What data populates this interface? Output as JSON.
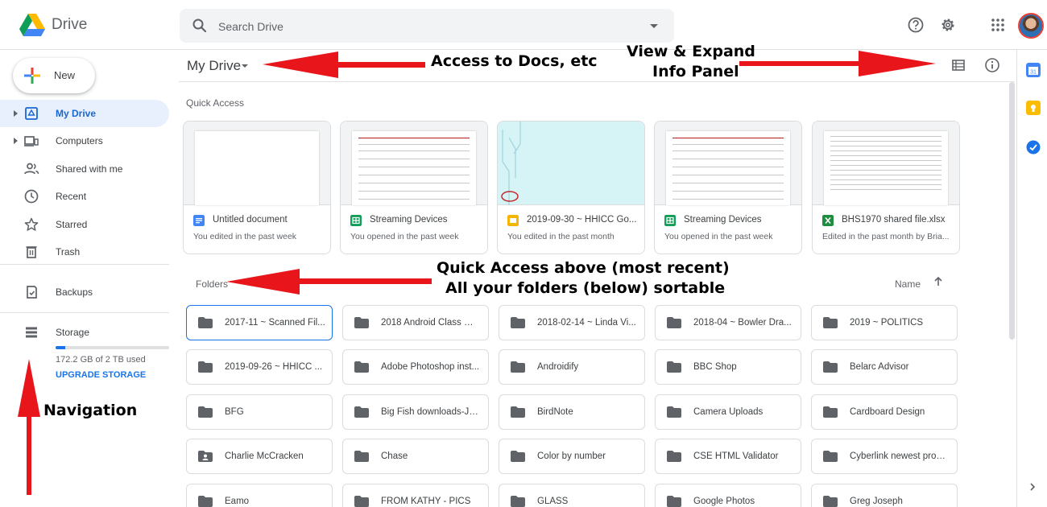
{
  "header": {
    "app_title": "Drive",
    "search_placeholder": "Search Drive",
    "icons": [
      "drive-logo-icon",
      "search-icon",
      "search-options-icon",
      "help-icon",
      "settings-icon",
      "apps-icon",
      "avatar"
    ]
  },
  "sidebar": {
    "new_label": "New",
    "items": [
      {
        "label": "My Drive",
        "icon": "my-drive-icon",
        "active": true,
        "expandable": true
      },
      {
        "label": "Computers",
        "icon": "computers-icon",
        "expandable": true
      },
      {
        "label": "Shared with me",
        "icon": "shared-icon"
      },
      {
        "label": "Recent",
        "icon": "clock-icon"
      },
      {
        "label": "Starred",
        "icon": "star-icon"
      },
      {
        "label": "Trash",
        "icon": "trash-icon"
      },
      {
        "label": "Backups",
        "icon": "backups-icon"
      },
      {
        "label": "Storage",
        "icon": "storage-icon"
      }
    ],
    "storage_used": "172.2 GB of 2 TB used",
    "storage_fraction": 0.086,
    "upgrade_label": "UPGRADE STORAGE"
  },
  "main": {
    "breadcrumb": "My Drive",
    "quick_access_label": "Quick Access",
    "quick_access": [
      {
        "name": "Untitled document",
        "sub": "You edited in the past week",
        "type": "doc",
        "color": "#4285f4"
      },
      {
        "name": "Streaming Devices",
        "sub": "You opened in the past week",
        "type": "sheet",
        "color": "#0f9d58"
      },
      {
        "name": "2019-09-30 ~ HHICC Go...",
        "sub": "You edited in the past month",
        "type": "slides",
        "color": "#f4b400"
      },
      {
        "name": "Streaming Devices",
        "sub": "You opened in the past week",
        "type": "sheet",
        "color": "#0f9d58"
      },
      {
        "name": "BHS1970 shared file.xlsx",
        "sub": "Edited in the past month by Bria...",
        "type": "excel",
        "color": "#1e8e3e"
      }
    ],
    "folders_label": "Folders",
    "sort_label": "Name",
    "folders": [
      "2017-11 ~ Scanned Fil...",
      "2018 Android Class @ ...",
      "2018-02-14 ~ Linda Vi...",
      "2018-04 ~ Bowler Dra...",
      "2019 ~ POLITICS",
      "2019-09-26 ~ HHICC ...",
      "Adobe Photoshop inst...",
      "Androidify",
      "BBC Shop",
      "Belarc Advisor",
      "BFG",
      "Big Fish downloads-JL...",
      "BirdNote",
      "Camera Uploads",
      "Cardboard Design",
      "Charlie McCracken",
      "Chase",
      "Color by number",
      "CSE HTML Validator",
      "Cyberlink newest progr...",
      "Eamo",
      "FROM KATHY - PICS",
      "GLASS",
      "Google Photos",
      "Greg Joseph"
    ]
  },
  "side_panel": {
    "icons": [
      "calendar-icon",
      "keep-icon",
      "tasks-icon",
      "expand-panel-icon"
    ],
    "colors": {
      "calendar": "#4285f4",
      "keep": "#fbbc04",
      "tasks": "#1a73e8"
    }
  },
  "annotations": {
    "access": "Access to Docs, etc",
    "view_line1": "View & Expand",
    "view_line2": "Info Panel",
    "qa_line1": "Quick Access above (most recent)",
    "qa_line2": "All your folders (below) sortable",
    "nav": "Navigation"
  }
}
